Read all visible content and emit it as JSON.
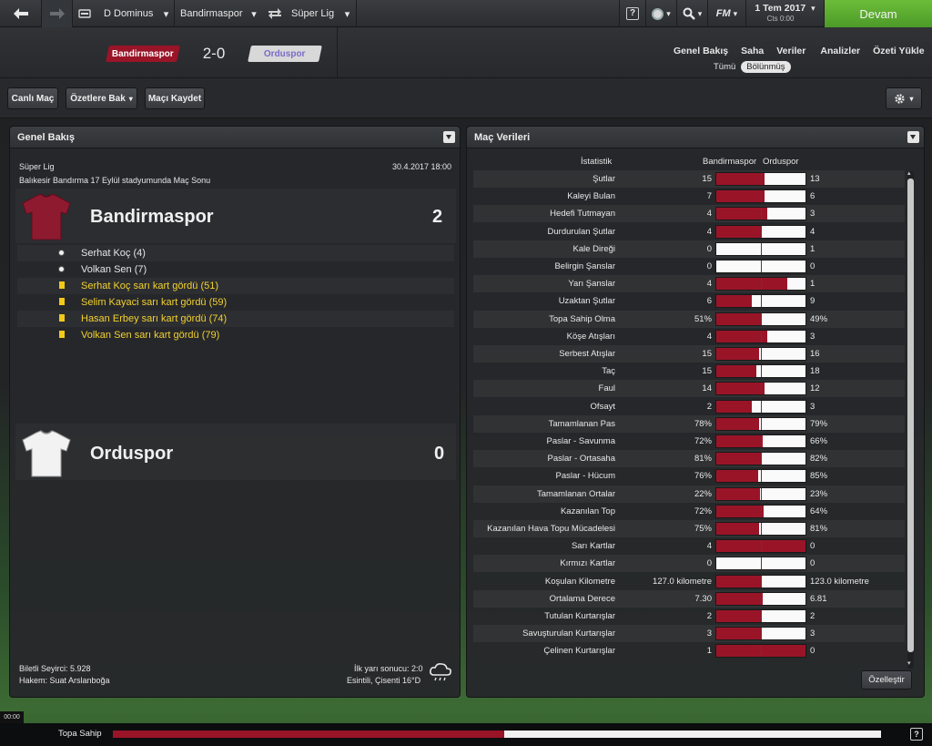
{
  "topbar": {
    "manager": "D Dominus",
    "club": "Bandirmaspor",
    "competition": "Süper Lig",
    "help": "?",
    "fm_logo": "FM",
    "date": "1 Tem 2017",
    "day": "Cts 0:00",
    "continue": "Devam"
  },
  "match": {
    "home": "Bandirmaspor",
    "score": "2-0",
    "away": "Orduspor"
  },
  "subnav": {
    "items": [
      "Genel Bakış",
      "Saha",
      "Veriler",
      "Analizler",
      "Özeti Yükle"
    ],
    "filters": [
      "Tümü",
      "Bölünmüş"
    ]
  },
  "toolbar": {
    "live": "Canlı Maç",
    "highlights": "Özetlere Bak",
    "save": "Maçı Kaydet"
  },
  "overview": {
    "title": "Genel Bakış",
    "competition": "Süper Lig",
    "datetime": "30.4.2017 18:00",
    "venue": "Balıkesir Bandırma 17 Eylül stadyumunda Maç Sonu",
    "home_name": "Bandirmaspor",
    "home_goals": "2",
    "away_name": "Orduspor",
    "away_goals": "0",
    "events": [
      {
        "text": "Serhat Koç (4)",
        "type": "goal"
      },
      {
        "text": "Volkan Sen (7)",
        "type": "goal"
      },
      {
        "text": "Serhat Koç sarı kart gördü (51)",
        "type": "yellow"
      },
      {
        "text": "Selim Kayaci sarı kart gördü (59)",
        "type": "yellow"
      },
      {
        "text": "Hasan Erbey sarı kart gördü (74)",
        "type": "yellow"
      },
      {
        "text": "Volkan Sen sarı kart gördü (79)",
        "type": "yellow"
      }
    ],
    "attendance": "Biletli Seyirci: 5.928",
    "referee": "Hakem: Suat Arslanboğa",
    "halftime": "İlk yarı sonucu: 2:0",
    "weather": "Esintili, Çisenti 16°D"
  },
  "stats": {
    "title": "Maç Verileri",
    "col_stat": "İstatistik",
    "col_home": "Bandirmaspor",
    "col_away": "Orduspor",
    "customize": "Özelleştir",
    "rows": [
      {
        "label": "Şutlar",
        "home": "15",
        "away": "13",
        "share": 0.54
      },
      {
        "label": "Kaleyi Bulan",
        "home": "7",
        "away": "6",
        "share": 0.54
      },
      {
        "label": "Hedefi Tutmayan",
        "home": "4",
        "away": "3",
        "share": 0.57
      },
      {
        "label": "Durdurulan Şutlar",
        "home": "4",
        "away": "4",
        "share": 0.5
      },
      {
        "label": "Kale Direği",
        "home": "0",
        "away": "1",
        "share": 0
      },
      {
        "label": "Belirgin Şanslar",
        "home": "0",
        "away": "0",
        "share": 0
      },
      {
        "label": "Yarı Şanslar",
        "home": "4",
        "away": "1",
        "share": 0.8
      },
      {
        "label": "Uzaktan Şutlar",
        "home": "6",
        "away": "9",
        "share": 0.4
      },
      {
        "label": "Topa Sahip Olma",
        "home": "51%",
        "away": "49%",
        "share": 0.51
      },
      {
        "label": "Köşe Atışları",
        "home": "4",
        "away": "3",
        "share": 0.57
      },
      {
        "label": "Serbest Atışlar",
        "home": "15",
        "away": "16",
        "share": 0.48
      },
      {
        "label": "Taç",
        "home": "15",
        "away": "18",
        "share": 0.45
      },
      {
        "label": "Faul",
        "home": "14",
        "away": "12",
        "share": 0.54
      },
      {
        "label": "Ofsayt",
        "home": "2",
        "away": "3",
        "share": 0.4
      },
      {
        "label": "Tamamlanan Pas",
        "home": "78%",
        "away": "79%",
        "share": 0.48
      },
      {
        "label": "Paslar - Savunma",
        "home": "72%",
        "away": "66%",
        "share": 0.52
      },
      {
        "label": "Paslar - Ortasaha",
        "home": "81%",
        "away": "82%",
        "share": 0.5
      },
      {
        "label": "Paslar - Hücum",
        "home": "76%",
        "away": "85%",
        "share": 0.47
      },
      {
        "label": "Tamamlanan Ortalar",
        "home": "22%",
        "away": "23%",
        "share": 0.49
      },
      {
        "label": "Kazanılan Top",
        "home": "72%",
        "away": "64%",
        "share": 0.53
      },
      {
        "label": "Kazanılan Hava Topu Mücadelesi",
        "home": "75%",
        "away": "81%",
        "share": 0.48
      },
      {
        "label": "Sarı Kartlar",
        "home": "4",
        "away": "0",
        "share": 1
      },
      {
        "label": "Kırmızı Kartlar",
        "home": "0",
        "away": "0",
        "share": 0
      },
      {
        "label": "Koşulan Kilometre",
        "home": "127.0 kilometre",
        "away": "123.0 kilometre",
        "share": 0.51
      },
      {
        "label": "Ortalama Derece",
        "home": "7.30",
        "away": "6.81",
        "share": 0.52
      },
      {
        "label": "Tutulan Kurtarışlar",
        "home": "2",
        "away": "2",
        "share": 0.5
      },
      {
        "label": "Savuşturulan Kurtarışlar",
        "home": "3",
        "away": "3",
        "share": 0.5
      },
      {
        "label": "Çelinen Kurtarışlar",
        "home": "1",
        "away": "0",
        "share": 1
      }
    ]
  },
  "footer": {
    "clock": "00:00",
    "possession_label": "Topa Sahip",
    "possession_home": 0.51,
    "help": "?"
  },
  "colors": {
    "home": "#9a1428",
    "away": "#f0f0f0",
    "continue": "#5aa830"
  }
}
